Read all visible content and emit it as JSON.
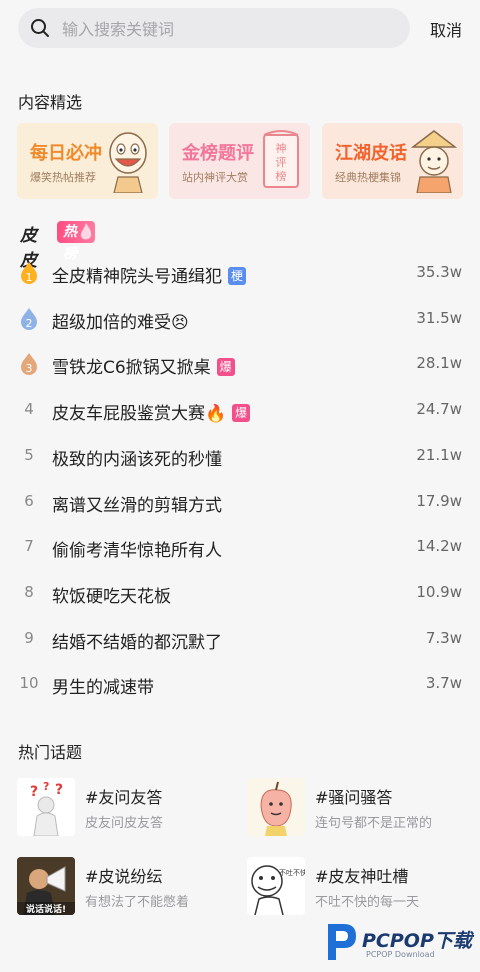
{
  "search": {
    "placeholder": "输入搜索关键词",
    "value": "",
    "cancel_label": "取消"
  },
  "featured": {
    "section_title": "内容精选",
    "cards": [
      {
        "title": "每日必冲",
        "subtitle": "爆笑热帖推荐",
        "art_text": "",
        "bg": "#fbeed9",
        "title_color": "#f08a2b"
      },
      {
        "title": "金榜题评",
        "subtitle": "站内神评大赏",
        "art_text": "神评榜",
        "bg": "#fbe6e6",
        "title_color": "#f2779a"
      },
      {
        "title": "江湖皮话",
        "subtitle": "经典热梗集锦",
        "art_text": "",
        "bg": "#fbe7db",
        "title_color": "#f2632e"
      }
    ]
  },
  "hot_list": {
    "brand": "皮皮",
    "badge": "热榜",
    "tag_colors": {
      "梗": "#5b8def",
      "爆": "#f2508b"
    },
    "items": [
      {
        "rank": "1",
        "medal": "gold",
        "title": "全皮精神院头号通缉犯",
        "tag": "梗",
        "emoji": "",
        "score": "35.3w"
      },
      {
        "rank": "2",
        "medal": "silver",
        "title": "超级加倍的难受",
        "tag": "",
        "emoji": "😣",
        "score": "31.5w"
      },
      {
        "rank": "3",
        "medal": "bronze",
        "title": "雪铁龙C6掀锅又掀桌",
        "tag": "爆",
        "emoji": "",
        "score": "28.1w"
      },
      {
        "rank": "4",
        "medal": "",
        "title": "皮友车屁股鉴赏大赛",
        "tag": "爆",
        "emoji": "🔥",
        "score": "24.7w"
      },
      {
        "rank": "5",
        "medal": "",
        "title": "极致的内涵该死的秒懂",
        "tag": "",
        "emoji": "",
        "score": "21.1w"
      },
      {
        "rank": "6",
        "medal": "",
        "title": "离谱又丝滑的剪辑方式",
        "tag": "",
        "emoji": "",
        "score": "17.9w"
      },
      {
        "rank": "7",
        "medal": "",
        "title": "偷偷考清华惊艳所有人",
        "tag": "",
        "emoji": "",
        "score": "14.2w"
      },
      {
        "rank": "8",
        "medal": "",
        "title": "软饭硬吃天花板",
        "tag": "",
        "emoji": "",
        "score": "10.9w"
      },
      {
        "rank": "9",
        "medal": "",
        "title": "结婚不结婚的都沉默了",
        "tag": "",
        "emoji": "",
        "score": "7.3w"
      },
      {
        "rank": "10",
        "medal": "",
        "title": "男生的减速带",
        "tag": "",
        "emoji": "",
        "score": "3.7w"
      }
    ]
  },
  "topics": {
    "section_title": "热门话题",
    "items": [
      {
        "title": "#友问友答",
        "subtitle": "皮友问皮友答",
        "thumb_text": ""
      },
      {
        "title": "#骚问骚答",
        "subtitle": "连句号都不是正常的",
        "thumb_text": ""
      },
      {
        "title": "#皮说纷纭",
        "subtitle": "有想法了不能憋着",
        "thumb_text": "说话说话!"
      },
      {
        "title": "#皮友神吐槽",
        "subtitle": "不吐不快的每一天",
        "thumb_text": "不吐不快"
      }
    ]
  },
  "watermark": {
    "brand": "PCPOP下载",
    "sub": "PCPOP Download"
  }
}
